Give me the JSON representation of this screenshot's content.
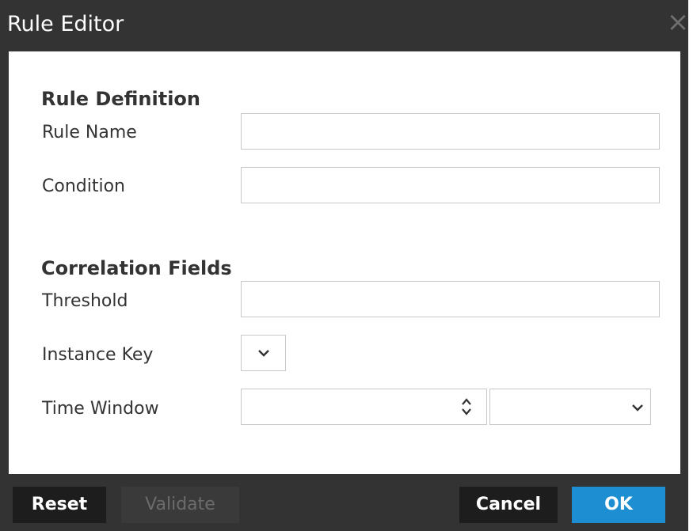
{
  "window": {
    "title": "Rule Editor"
  },
  "rule_definition": {
    "heading": "Rule Definition",
    "rule_name_label": "Rule Name",
    "rule_name_value": "",
    "condition_label": "Condition",
    "condition_value": ""
  },
  "correlation_fields": {
    "heading": "Correlation Fields",
    "threshold_label": "Threshold",
    "threshold_value": "",
    "instance_key_label": "Instance Key",
    "time_window_label": "Time Window",
    "time_window_value": "",
    "time_window_unit": ""
  },
  "buttons": {
    "reset": "Reset",
    "validate": "Validate",
    "cancel": "Cancel",
    "ok": "OK"
  },
  "icons": {
    "close": "close-icon",
    "chevron": "chevron-down-icon",
    "spinner": "spinner-arrows-icon"
  },
  "colors": {
    "header_bg": "#333333",
    "primary": "#1d8ed1",
    "button_dark": "#1d1d1d"
  }
}
